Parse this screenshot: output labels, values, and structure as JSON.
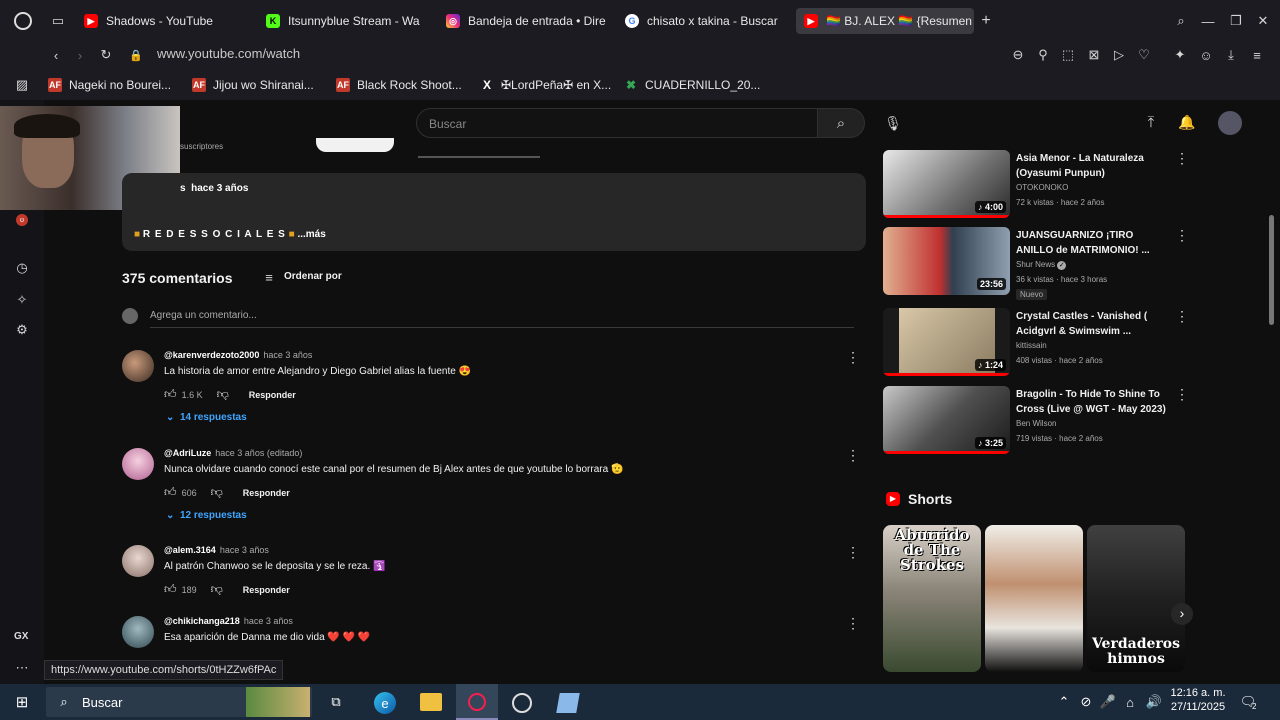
{
  "tabs": [
    {
      "label": "Shadows - YouTube",
      "icon": "youtube-icon"
    },
    {
      "label": "Itsunnyblue Stream - Wa",
      "icon": "kick-icon"
    },
    {
      "label": "Bandeja de entrada • Dire",
      "icon": "instagram-icon"
    },
    {
      "label": "chisato x takina - Buscar",
      "icon": "google-icon"
    },
    {
      "label": "🏳️‍🌈 BJ. ALEX 🏳️‍🌈 {Resumen",
      "icon": "youtube-icon"
    }
  ],
  "new_tab": "+",
  "url": "www.youtube.com/watch",
  "bookmarks": [
    {
      "label": "Nageki no Bourei...",
      "icon": "af"
    },
    {
      "label": "Jijou wo Shiranai...",
      "icon": "af"
    },
    {
      "label": "Black Rock Shoot...",
      "icon": "af"
    },
    {
      "label": "✠LordPeña✠ en X...",
      "icon": "x"
    },
    {
      "label": "CUADERNILLO_20...",
      "icon": "sheet"
    }
  ],
  "search": {
    "placeholder": "Buscar"
  },
  "description": {
    "subscribers": "suscriptores",
    "date": "hace 3 años",
    "date_prefix": "s",
    "social": "R E D E S   S O C I A L E S",
    "more": "...más"
  },
  "comments_header": {
    "count": "375 comentarios",
    "sort": "Ordenar por",
    "add_placeholder": "Agrega un comentario..."
  },
  "comments": [
    {
      "author": "@karenverdezoto2000",
      "time": "hace 3 años",
      "text": "La historia de amor entre Alejandro y Diego Gabriel alias la fuente 😍",
      "likes": "1.6 K",
      "reply": "Responder",
      "replies": "14 respuestas"
    },
    {
      "author": "@AdriLuze",
      "time": "hace 3 años (editado)",
      "text": "Nunca olvidare cuando conocí este canal por el resumen de Bj Alex antes de que youtube lo borrara 🫡",
      "likes": "606",
      "reply": "Responder",
      "replies": "12 respuestas"
    },
    {
      "author": "@alem.3164",
      "time": "hace 3 años",
      "text": "Al patrón Chanwoo se le deposita y se le reza. 🛐",
      "likes": "189",
      "reply": "Responder",
      "replies": ""
    },
    {
      "author": "@chikichanga218",
      "time": "hace 3 años",
      "text": "Esa aparición de Danna me dio vida ❤️ ❤️ ❤️",
      "likes": "",
      "reply": "",
      "replies": ""
    }
  ],
  "videos": [
    {
      "title": "Asia Menor - La Naturaleza (Oyasumi Punpun)",
      "channel": "OTOKONOKO",
      "meta": "72 k vistas · hace 2 años",
      "duration": "4:00",
      "badge": ""
    },
    {
      "title": "JUANSGUARNIZO ¡TIRO ANILLO de MATRIMONIO! ...",
      "channel": "Shur News",
      "meta": "36 k vistas · hace 3 horas",
      "duration": "23:56",
      "badge": "Nuevo"
    },
    {
      "title": "Crystal Castles - Vanished ( Acidgvrl & Swimswim ...",
      "channel": "kittissain",
      "meta": "408 vistas · hace 2 años",
      "duration": "1:24",
      "badge": ""
    },
    {
      "title": "Bragolin - To Hide To Shine To Cross  (Live @ WGT - May 2023)",
      "channel": "Ben Wilson",
      "meta": "719 vistas · hace 2 años",
      "duration": "3:25",
      "badge": ""
    }
  ],
  "shorts": {
    "title": "Shorts",
    "items": [
      {
        "overlay": "Aburrido de The Strokes"
      },
      {
        "overlay": ""
      },
      {
        "overlay": "Verdaderos himnos"
      }
    ]
  },
  "status_url": "https://www.youtube.com/shorts/0tHZZw6fPAc",
  "taskbar": {
    "search": "Buscar",
    "time": "12:16 a. m.",
    "date": "27/11/2025",
    "notif": "2"
  },
  "gx_label": "GX",
  "colors": {
    "accent": "#3ea6ff",
    "youtube_red": "#ff0000",
    "bg": "#0f0f0f"
  }
}
